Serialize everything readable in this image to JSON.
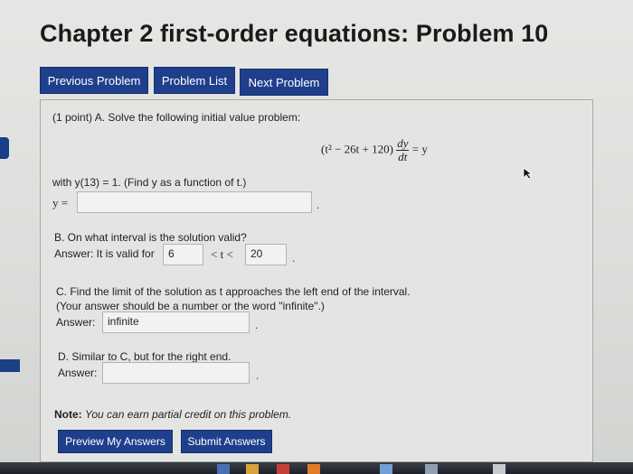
{
  "page_title": "Chapter 2 first-order equations: Problem 10",
  "nav": {
    "previous": "Previous Problem",
    "list": "Problem List",
    "next": "Next Problem"
  },
  "problem": {
    "intro": "(1 point) A. Solve the following initial value problem:",
    "equation_left": "(t² − 26t + 120)",
    "equation_num": "dy",
    "equation_den": "dt",
    "equation_right": "= y",
    "condition": "with y(13) = 1. (Find y as a function of t.)",
    "y_label": "y =",
    "y_value": "",
    "part_b_question": "B. On what interval is the solution valid?",
    "part_b_answer_label": "Answer: It is valid for",
    "part_b_lower": "6",
    "part_b_between": "< t <",
    "part_b_upper": "20",
    "part_c_question": "C. Find the limit of the solution as t approaches the left end of the interval.",
    "part_c_note": "(Your answer should be a number or the word \"infinite\".)",
    "part_c_label": "Answer:",
    "part_c_value": "infinite",
    "part_d_question": "D. Similar to C, but for the right end.",
    "part_d_label": "Answer:",
    "part_d_value": "",
    "note_label": "Note:",
    "note_text": "You can earn partial credit on this problem."
  },
  "actions": {
    "preview": "Preview My Answers",
    "submit": "Submit Answers"
  },
  "colors": {
    "button_blue": "#1f3f8c",
    "background": "#e4e5e2"
  }
}
